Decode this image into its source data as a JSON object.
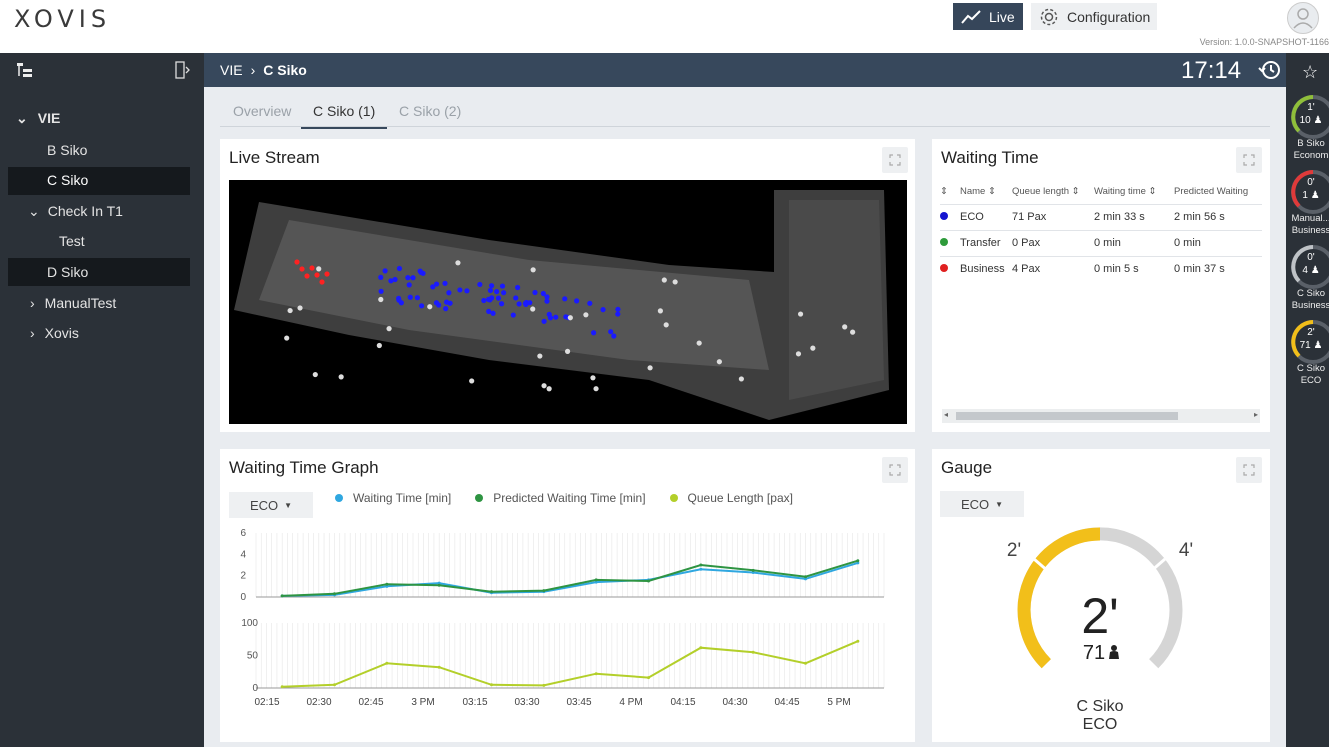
{
  "brand": {
    "logo": "XOVIS"
  },
  "topbar": {
    "live_label": "Live",
    "config_label": "Configuration",
    "version": "Version: 1.0.0-SNAPSHOT-1166"
  },
  "sidebar": {
    "items": [
      {
        "label": "VIE",
        "expander": "⌄"
      },
      {
        "label": "B Siko"
      },
      {
        "label": "C Siko"
      },
      {
        "label": "Check In T1",
        "expander": "⌄"
      },
      {
        "label": "Test"
      },
      {
        "label": "D Siko"
      },
      {
        "label": "ManualTest",
        "expander": "›"
      },
      {
        "label": "Xovis",
        "expander": "›"
      }
    ]
  },
  "header": {
    "crumb_root": "VIE",
    "crumb_sep": "›",
    "crumb_current": "C Siko",
    "clock": "17:14"
  },
  "tabs": [
    {
      "label": "Overview"
    },
    {
      "label": "C Siko (1)"
    },
    {
      "label": "C Siko (2)"
    }
  ],
  "live_stream": {
    "title": "Live Stream"
  },
  "waiting_time": {
    "title": "Waiting Time",
    "columns": [
      "Name",
      "Queue length",
      "Waiting time",
      "Predicted Waiting"
    ],
    "rows": [
      {
        "name": "ECO",
        "queue": "71 Pax",
        "wait": "2 min 33 s",
        "pred": "2 min 56 s",
        "color": "#1515d0"
      },
      {
        "name": "Transfer",
        "queue": "0 Pax",
        "wait": "0 min",
        "pred": "0 min",
        "color": "#2e9b3b"
      },
      {
        "name": "Business",
        "queue": "4 Pax",
        "wait": "0 min 5 s",
        "pred": "0 min 37 s",
        "color": "#e02020"
      }
    ]
  },
  "graph": {
    "title": "Waiting Time Graph",
    "select": "ECO",
    "legend": [
      {
        "label": "Waiting Time [min]",
        "color": "#2fa7e0"
      },
      {
        "label": "Predicted Waiting Time [min]",
        "color": "#2e9442"
      },
      {
        "label": "Queue Length [pax]",
        "color": "#b3cf2a"
      }
    ]
  },
  "chart_data": [
    {
      "type": "line",
      "ylim": [
        0,
        6
      ],
      "y_ticks": [
        "6",
        "4",
        "2",
        "0"
      ],
      "x": [
        "02:15",
        "02:30",
        "02:45",
        "3 PM",
        "03:15",
        "03:30",
        "03:45",
        "4 PM",
        "04:15",
        "04:30",
        "04:45",
        "5 PM"
      ],
      "series": [
        {
          "name": "Waiting Time [min]",
          "color": "#2fa7e0",
          "values": [
            0.1,
            0.2,
            1.0,
            1.3,
            0.4,
            0.5,
            1.4,
            1.6,
            2.6,
            2.3,
            1.7,
            3.2
          ]
        },
        {
          "name": "Predicted Waiting Time [min]",
          "color": "#2e9442",
          "values": [
            0.1,
            0.3,
            1.2,
            1.1,
            0.5,
            0.6,
            1.6,
            1.5,
            3.0,
            2.5,
            1.9,
            3.4
          ]
        }
      ]
    },
    {
      "type": "line",
      "ylim": [
        0,
        100
      ],
      "y_ticks": [
        "100",
        "50",
        "0"
      ],
      "x": [
        "02:15",
        "02:30",
        "02:45",
        "3 PM",
        "03:15",
        "03:30",
        "03:45",
        "4 PM",
        "04:15",
        "04:30",
        "04:45",
        "5 PM"
      ],
      "series": [
        {
          "name": "Queue Length [pax]",
          "color": "#b3cf2a",
          "values": [
            2,
            5,
            38,
            32,
            5,
            4,
            22,
            16,
            62,
            55,
            38,
            72
          ]
        }
      ]
    }
  ],
  "gauge": {
    "title": "Gauge",
    "select": "ECO",
    "value": "2'",
    "pax": "71",
    "mark_low": "2'",
    "mark_high": "4'",
    "name": "C Siko",
    "queue": "ECO",
    "fill_fraction": 0.5,
    "color": "#f2bf1a"
  },
  "right_gauges": [
    {
      "time": "1'",
      "pax": "10",
      "name1": "B Siko",
      "name2": "Econom",
      "color": "#8fbf3a"
    },
    {
      "time": "0'",
      "pax": "1",
      "name1": "Manual...",
      "name2": "Business",
      "color": "#e03a3a"
    },
    {
      "time": "0'",
      "pax": "4",
      "name1": "C Siko",
      "name2": "Business",
      "color": "#bfc3c7"
    },
    {
      "time": "2'",
      "pax": "71",
      "name1": "C Siko",
      "name2": "ECO",
      "color": "#f2bf1a"
    }
  ]
}
